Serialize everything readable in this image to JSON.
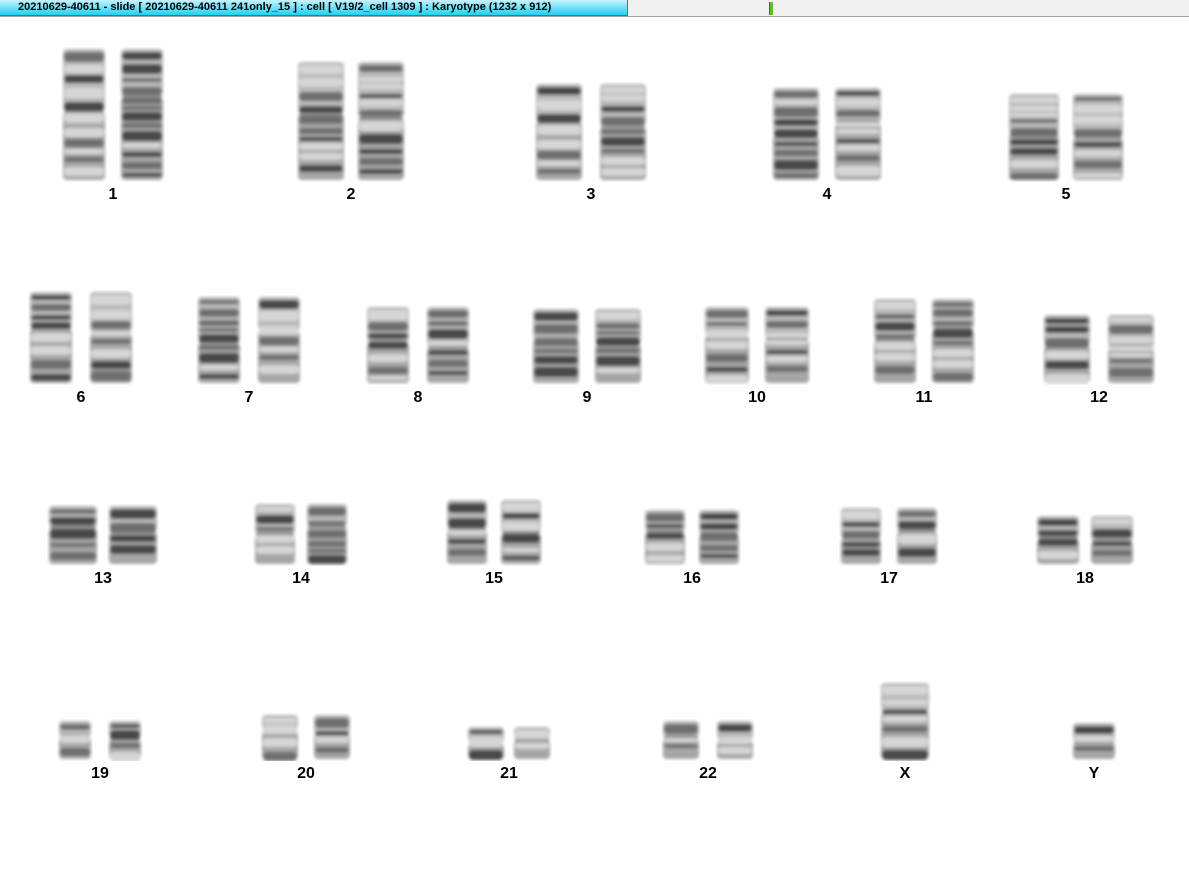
{
  "window": {
    "title": "20210629-40611 - slide [ 20210629-40611 241only_15 ] : cell [ V19/2_cell 1309 ] : Karyotype  (1232 x 912)"
  },
  "karyotype": {
    "pairs": [
      {
        "label": "1",
        "count": 2
      },
      {
        "label": "2",
        "count": 2
      },
      {
        "label": "3",
        "count": 2
      },
      {
        "label": "4",
        "count": 2
      },
      {
        "label": "5",
        "count": 2
      },
      {
        "label": "6",
        "count": 2
      },
      {
        "label": "7",
        "count": 2
      },
      {
        "label": "8",
        "count": 2
      },
      {
        "label": "9",
        "count": 2
      },
      {
        "label": "10",
        "count": 2
      },
      {
        "label": "11",
        "count": 2
      },
      {
        "label": "12",
        "count": 2
      },
      {
        "label": "13",
        "count": 2
      },
      {
        "label": "14",
        "count": 2
      },
      {
        "label": "15",
        "count": 2
      },
      {
        "label": "16",
        "count": 2
      },
      {
        "label": "17",
        "count": 2
      },
      {
        "label": "18",
        "count": 2
      },
      {
        "label": "19",
        "count": 2
      },
      {
        "label": "20",
        "count": 2
      },
      {
        "label": "21",
        "count": 2
      },
      {
        "label": "22",
        "count": 2
      },
      {
        "label": "X",
        "count": 1
      },
      {
        "label": "Y",
        "count": 1
      }
    ]
  }
}
